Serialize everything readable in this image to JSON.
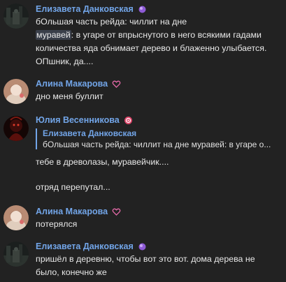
{
  "messages": [
    {
      "author": "Елизавета Данковская",
      "badge": "purple-orb-icon",
      "lines": [
        "бОльшая часть рейда: чиллит на дне",
        "муравей",
        ": в угаре от впрыснутого в него всякими гадами",
        "количества яда обнимает дерево и блаженно улыбается.",
        "ОПшник, да...."
      ]
    },
    {
      "author": "Алина Макарова",
      "badge": "pink-heart-outline-icon",
      "text": "дно меня буллит"
    },
    {
      "author": "Юлия Весенникова",
      "badge": "red-circle-emblem-icon",
      "reply": {
        "author": "Елизавета Данковская",
        "text": "бОльшая часть рейда: чиллит на дне муравей: в угаре о..."
      },
      "text": "тебе в древолазы, муравейчик....",
      "followup": "отряд перепутал..."
    },
    {
      "author": "Алина Макарова",
      "badge": "pink-heart-outline-icon",
      "text": "потерялся"
    },
    {
      "author": "Елизавета Данковская",
      "badge": "purple-orb-icon",
      "lines": [
        "пришёл в деревню, чтобы вот это вот. дома дерева не",
        "было, конечно же"
      ]
    }
  ],
  "colors": {
    "background": "#222222",
    "author": "#72a5e8",
    "text": "#e8e8e8",
    "quote_bar": "#72a5e8"
  }
}
